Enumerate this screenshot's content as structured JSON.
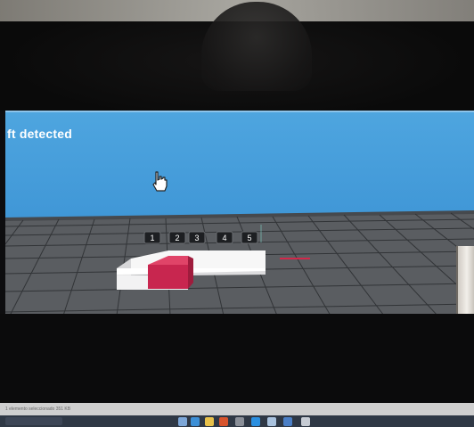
{
  "app": {
    "status_message": "ft detected"
  },
  "scene": {
    "grid_numbers": [
      "1",
      "2",
      "3",
      "4",
      "5"
    ],
    "sky_color": "#4ea5df",
    "floor_color": "#5b5d60",
    "block_color": "#f4f4f4",
    "highlight_cube_color": "#c8264f",
    "marker_color": "#d2284a"
  },
  "taskbar": {
    "status_text": "1 elemento seleccionado  351 KB",
    "icons": [
      "search-icon",
      "task-view-icon",
      "edge-icon",
      "file-explorer-icon",
      "store-icon",
      "mail-icon",
      "app-icon",
      "app-icon",
      "app-icon",
      "app-icon"
    ]
  }
}
